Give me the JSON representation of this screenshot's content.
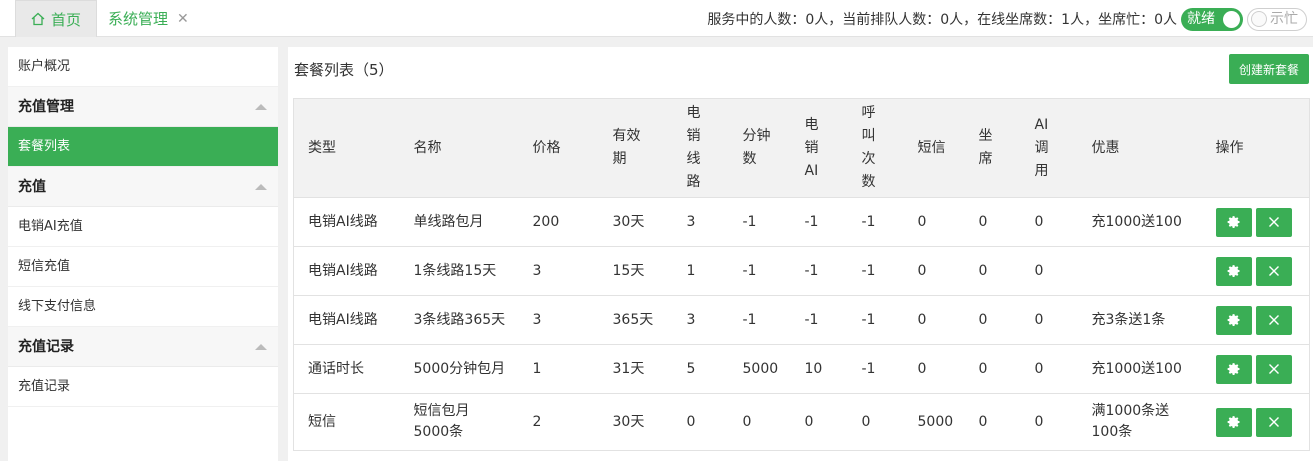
{
  "tabs": {
    "home": "首页",
    "system": "系统管理"
  },
  "status": {
    "text": "服务中的人数：0人，当前排队人数：0人，在线坐席数：1人，坐席忙：0人",
    "ready_label": "就绪",
    "busy_label": "示忙"
  },
  "sidebar": {
    "overview": "账户概况",
    "group_recharge_mgmt": "充值管理",
    "package_list": "套餐列表",
    "group_recharge": "充值",
    "ai_recharge": "电销AI充值",
    "sms_recharge": "短信充值",
    "offline_pay": "线下支付信息",
    "group_records": "充值记录",
    "records": "充值记录"
  },
  "main": {
    "title": "套餐列表（5）",
    "create_button": "创建新套餐",
    "columns": [
      "类型",
      "名称",
      "价格",
      "有效期",
      "电销线路",
      "分钟数",
      "电销AI",
      "呼叫次数",
      "短信",
      "坐席",
      "AI调用",
      "优惠",
      "操作"
    ],
    "rows": [
      [
        "电销AI线路",
        "单线路包月",
        "200",
        "30天",
        "3",
        "-1",
        "-1",
        "-1",
        "0",
        "0",
        "0",
        "充1000送100"
      ],
      [
        "电销AI线路",
        "1条线路15天",
        "3",
        "15天",
        "1",
        "-1",
        "-1",
        "-1",
        "0",
        "0",
        "0",
        ""
      ],
      [
        "电销AI线路",
        "3条线路365天",
        "3",
        "365天",
        "3",
        "-1",
        "-1",
        "-1",
        "0",
        "0",
        "0",
        "充3条送1条"
      ],
      [
        "通话时长",
        "5000分钟包月",
        "1",
        "31天",
        "5",
        "5000",
        "10",
        "-1",
        "0",
        "0",
        "0",
        "充1000送100"
      ],
      [
        "短信",
        "短信包月5000条",
        "2",
        "30天",
        "0",
        "0",
        "0",
        "0",
        "5000",
        "0",
        "0",
        "满1000条送100条"
      ]
    ]
  },
  "icons": {
    "home": "home-icon",
    "close": "close-icon",
    "settings": "gear-icon",
    "delete": "close-icon",
    "collapse": "caret-up-icon"
  },
  "colors": {
    "accent": "#3aae55"
  }
}
